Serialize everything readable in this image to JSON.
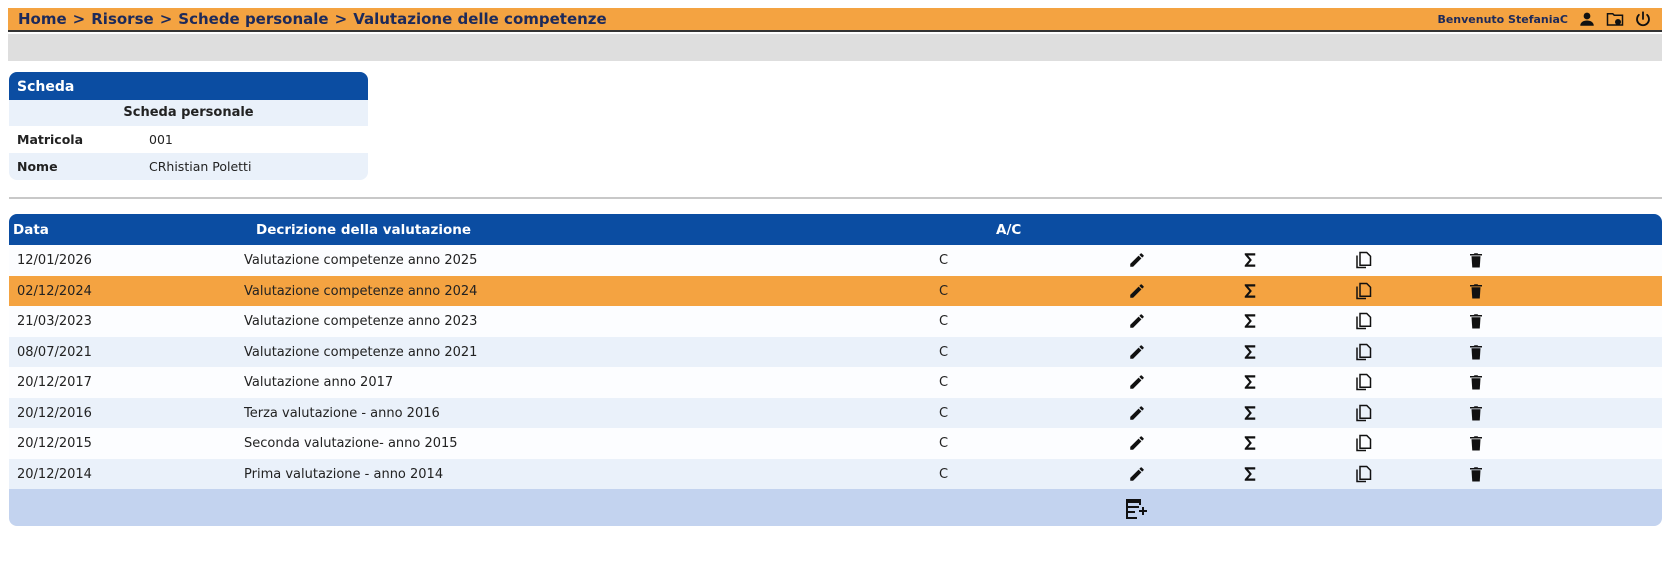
{
  "breadcrumb": [
    {
      "label": "Home"
    },
    {
      "label": "Risorse"
    },
    {
      "label": "Schede personale"
    },
    {
      "label": "Valutazione delle competenze"
    }
  ],
  "breadcrumb_separator": ">",
  "user": {
    "welcome": "Benvenuto StefaniaC"
  },
  "card": {
    "title": "Scheda",
    "subtitle": "Scheda personale",
    "fields": [
      {
        "label": "Matricola",
        "value": "001"
      },
      {
        "label": "Nome",
        "value": "CRhistian Poletti"
      }
    ]
  },
  "table": {
    "headers": {
      "date": "Data",
      "description": "Decrizione della valutazione",
      "ac": "A/C"
    },
    "rows": [
      {
        "date": "12/01/2026",
        "description": "Valutazione competenze anno 2025",
        "ac": "C",
        "selected": false
      },
      {
        "date": "02/12/2024",
        "description": "Valutazione competenze anno 2024",
        "ac": "C",
        "selected": true
      },
      {
        "date": "21/03/2023",
        "description": "Valutazione competenze anno 2023",
        "ac": "C",
        "selected": false
      },
      {
        "date": "08/07/2021",
        "description": "Valutazione competenze anno 2021",
        "ac": "C",
        "selected": false
      },
      {
        "date": "20/12/2017",
        "description": "Valutazione anno 2017",
        "ac": "C",
        "selected": false
      },
      {
        "date": "20/12/2016",
        "description": "Terza valutazione - anno 2016",
        "ac": "C",
        "selected": false
      },
      {
        "date": "20/12/2015",
        "description": "Seconda valutazione- anno 2015",
        "ac": "C",
        "selected": false
      },
      {
        "date": "20/12/2014",
        "description": "Prima valutazione - anno 2014",
        "ac": "C",
        "selected": false
      }
    ],
    "row_actions": [
      "edit-icon",
      "sum-icon",
      "copy-icon",
      "delete-icon"
    ],
    "footer_action": "add-note-icon"
  },
  "colors": {
    "accent": "#f4a341",
    "header_blue": "#0b4da2",
    "row_alt": "#eaf1fa",
    "footer": "#c3d3ef",
    "text_dark": "#1d2a5a"
  }
}
